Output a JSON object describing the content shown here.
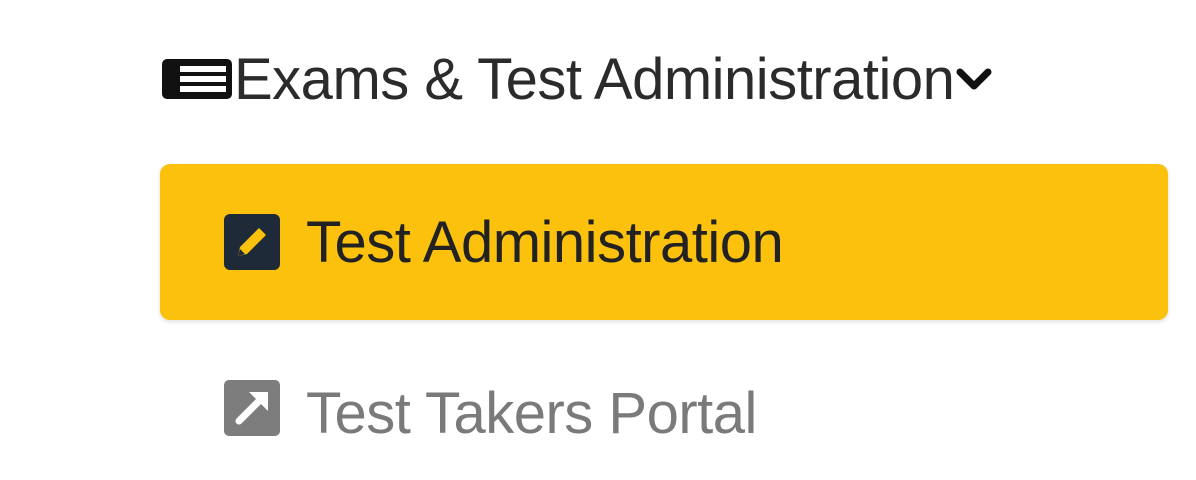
{
  "nav": {
    "group": {
      "label": "Exams & Test Administration",
      "icon": "list-table-icon",
      "expanded": true,
      "chevron_icon": "chevron-down-icon"
    },
    "items": [
      {
        "label": "Test Administration",
        "icon": "edit-square-icon",
        "active": true
      },
      {
        "label": "Test Takers Portal",
        "icon": "external-link-square-icon",
        "active": false
      }
    ]
  },
  "colors": {
    "active_bg": "#fcc10d",
    "active_text": "#222222",
    "inactive_text": "#7a7a7a",
    "group_text": "#2b2b2b",
    "icon_dark": "#1e2a38",
    "icon_gray": "#7d7d7d"
  }
}
